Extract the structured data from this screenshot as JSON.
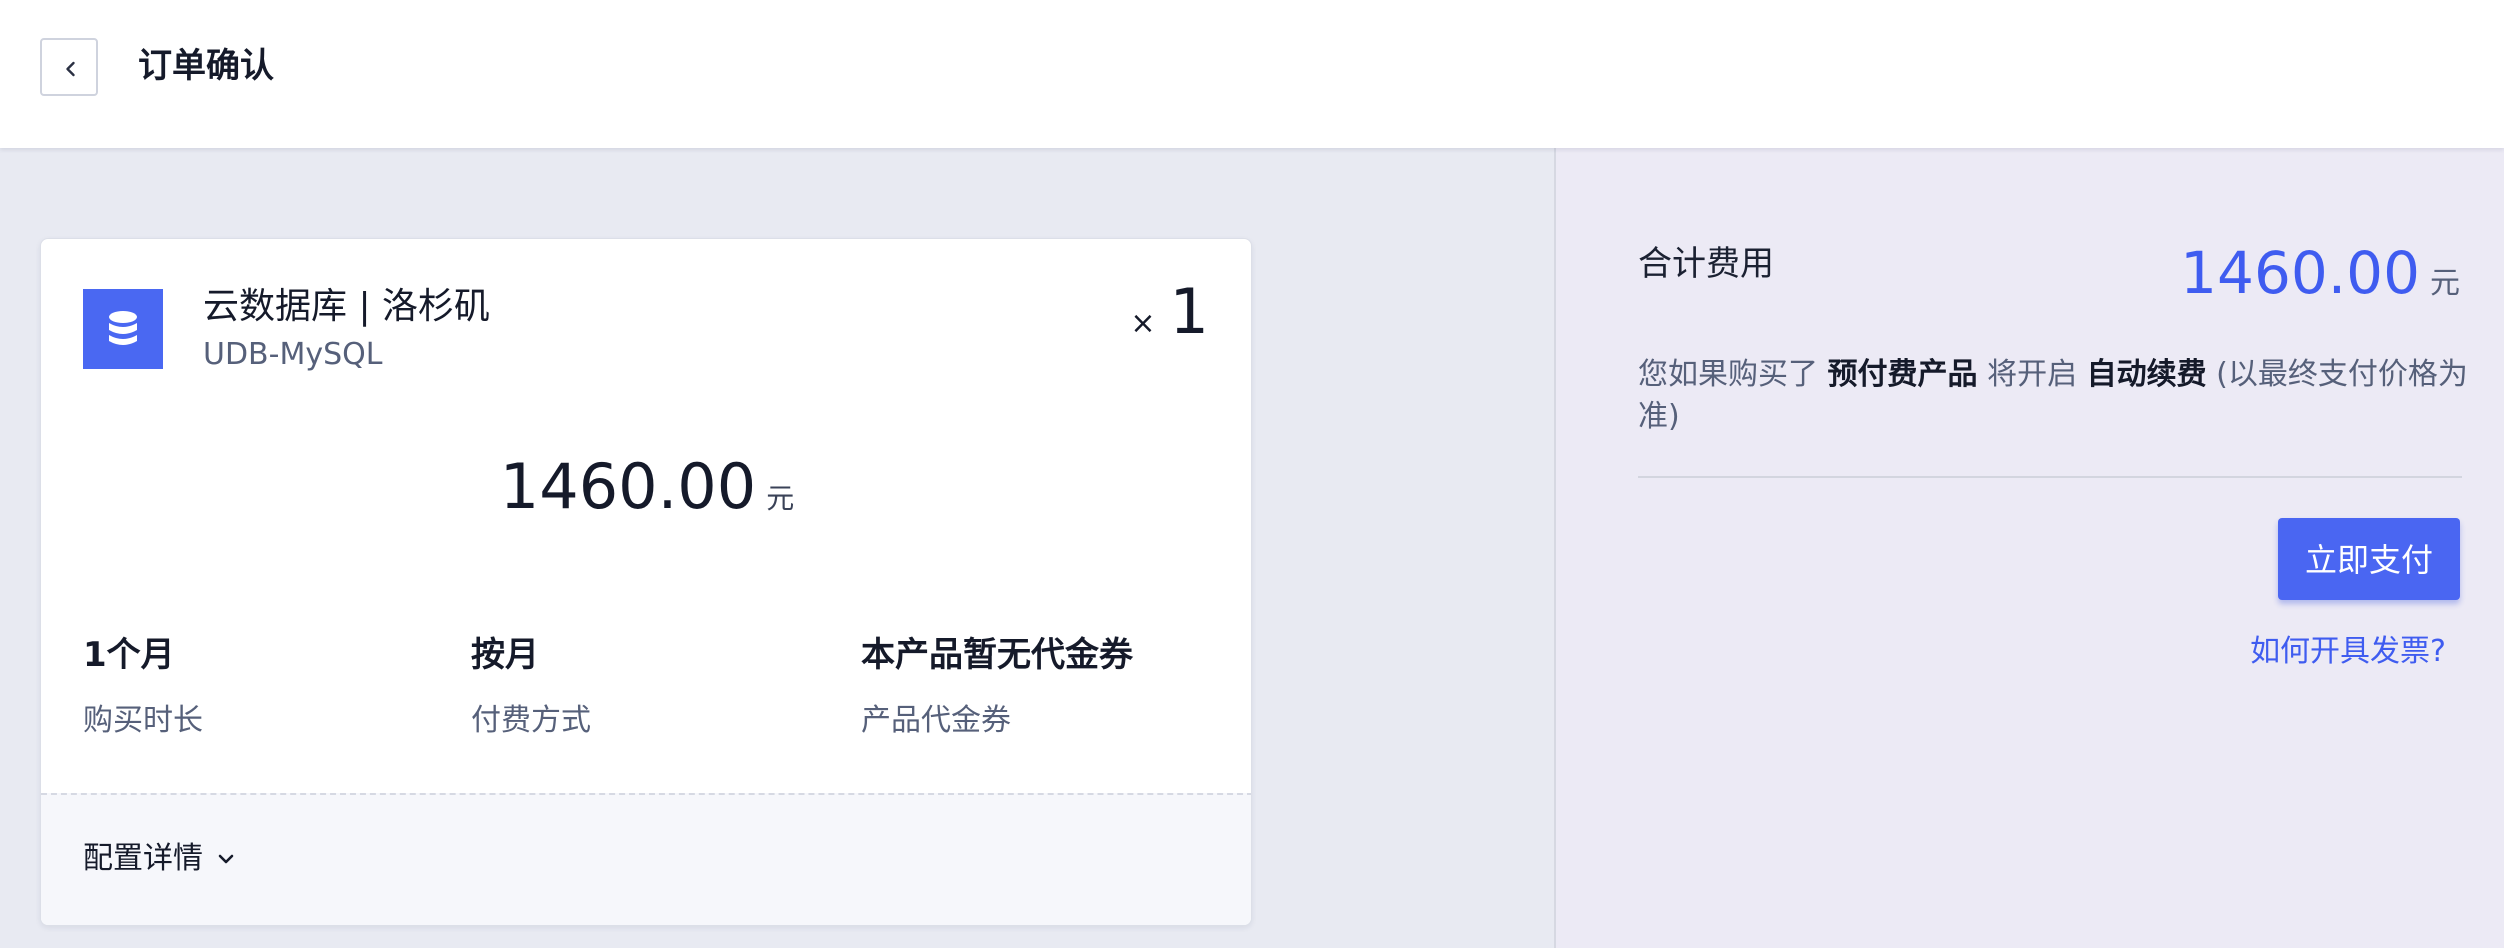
{
  "header": {
    "title": "订单确认",
    "back_icon": "chevron-left-icon"
  },
  "order": {
    "product_name": "云数据库 | 洛杉矶",
    "product_sub": "UDB-MySQL",
    "product_icon": "database-icon",
    "quantity_symbol": "×",
    "quantity": "1",
    "price": "1460.00",
    "price_unit": "元",
    "specs": [
      {
        "value": "1个月",
        "label": "购买时长"
      },
      {
        "value": "按月",
        "label": "付费方式"
      },
      {
        "value": "本产品暂无代金券",
        "label": "产品代金券"
      }
    ],
    "config_label": "配置详情",
    "config_icon": "chevron-down-icon"
  },
  "summary": {
    "total_label": "合计费用",
    "total_price": "1460.00",
    "total_unit": "元",
    "notice_prefix": "您如果购买了 ",
    "notice_bold1": "预付费产品",
    "notice_mid": " 将开启 ",
    "notice_bold2": "自动续费",
    "notice_suffix": " (以最终支付价格为准)",
    "pay_button": "立即支付",
    "invoice_link": "如何开具发票?"
  },
  "colors": {
    "accent": "#4a66f2",
    "price_blue": "#3f5cf0",
    "page_bg": "#e8eaf2",
    "summary_bg": "#eceaf5"
  }
}
